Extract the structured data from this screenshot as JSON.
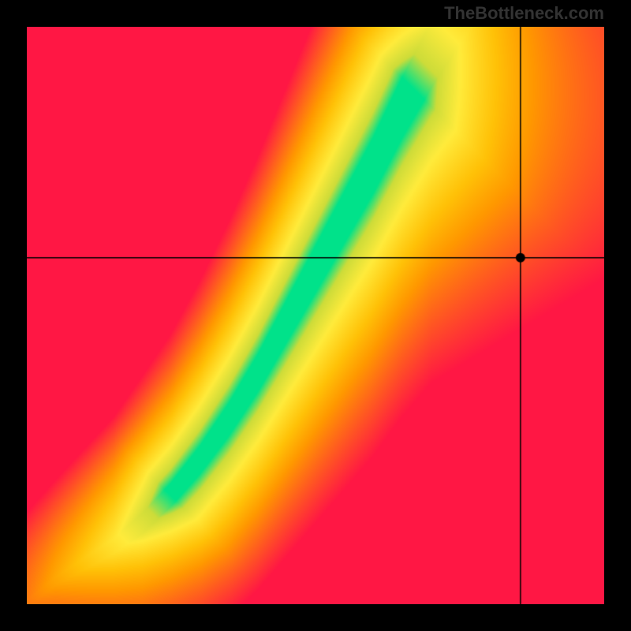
{
  "watermark": "TheBottleneck.com",
  "chart_data": {
    "type": "heatmap",
    "title": "",
    "xlabel": "",
    "ylabel": "",
    "xlim": [
      0,
      1
    ],
    "ylim": [
      0,
      1
    ],
    "grid": false,
    "legend": false,
    "marker": {
      "x": 0.855,
      "y": 0.6
    },
    "crosshair": {
      "x": 0.855,
      "y": 0.6
    },
    "optimal_curve": {
      "description": "green optimal ratio band; x is fraction across, y is fraction up",
      "x": [
        0.0,
        0.05,
        0.1,
        0.15,
        0.2,
        0.25,
        0.3,
        0.35,
        0.4,
        0.45,
        0.5,
        0.55,
        0.6,
        0.65,
        0.7,
        0.73
      ],
      "y_center": [
        0.0,
        0.04,
        0.07,
        0.1,
        0.14,
        0.19,
        0.25,
        0.32,
        0.4,
        0.49,
        0.58,
        0.67,
        0.76,
        0.86,
        0.95,
        1.0
      ],
      "half_width": [
        0.005,
        0.007,
        0.01,
        0.013,
        0.017,
        0.02,
        0.024,
        0.028,
        0.032,
        0.036,
        0.04,
        0.044,
        0.048,
        0.052,
        0.056,
        0.06
      ]
    },
    "color_stops": {
      "0.00": "#ff1744",
      "0.20": "#ff5722",
      "0.40": "#ff9800",
      "0.55": "#ffc107",
      "0.75": "#ffeb3b",
      "0.90": "#cddc39",
      "1.00": "#00e28a"
    }
  }
}
